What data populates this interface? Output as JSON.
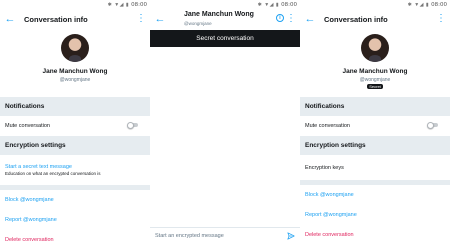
{
  "status_bar": {
    "icons": "✱ ▼◢ ▮",
    "time": "08:00"
  },
  "left_panel": {
    "title": "Conversation info",
    "profile": {
      "name": "Jane Manchun Wong",
      "handle": "@wongmjane"
    },
    "notifications_header": "Notifications",
    "mute_label": "Mute conversation",
    "encryption_header": "Encryption settings",
    "secret_title": "Start a secret text message",
    "secret_desc": "Education on what an encrypted conversation is",
    "block": "Block @wongmjane",
    "report": "Report @wongmjane",
    "delete": "Delete conversation"
  },
  "middle_panel": {
    "name": "Jane Manchun Wong",
    "handle": "@wongmjane",
    "banner": "Secret conversation",
    "composer_placeholder": "Start an encrypted message"
  },
  "right_panel": {
    "title": "Conversation info",
    "profile": {
      "name": "Jane Manchun Wong",
      "handle": "@wongmjane",
      "badge": "Secret"
    },
    "notifications_header": "Notifications",
    "mute_label": "Mute conversation",
    "encryption_header": "Encryption settings",
    "encryption_keys": "Encryption keys",
    "block": "Block @wongmjane",
    "report": "Report @wongmjane",
    "delete": "Delete conversation"
  },
  "colors": {
    "accent": "#1da1f2",
    "danger": "#e0245e",
    "section_bg": "#e6ecf0",
    "banner_bg": "#14171a"
  },
  "icons": [
    "back-arrow-icon",
    "overflow-menu-icon",
    "info-icon",
    "send-icon",
    "bluetooth-icon",
    "wifi-icon",
    "signal-icon",
    "battery-icon"
  ]
}
